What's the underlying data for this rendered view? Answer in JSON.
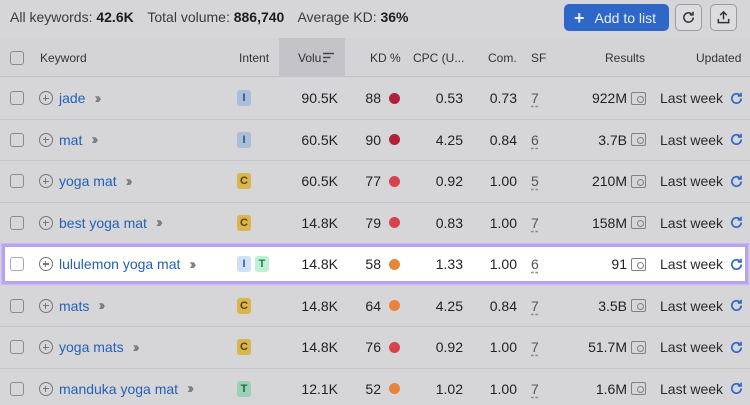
{
  "summary": {
    "keywords_label": "All keywords:",
    "keywords_value": "42.6K",
    "volume_label": "Total volume:",
    "volume_value": "886,740",
    "kd_label": "Average KD:",
    "kd_value": "36%"
  },
  "toolbar": {
    "add_label": "Add to list",
    "refresh_icon": "refresh-icon",
    "export_icon": "export-icon"
  },
  "columns": {
    "keyword": "Keyword",
    "intent": "Intent",
    "volume": "Volu",
    "kd": "KD %",
    "cpc": "CPC (U...",
    "com": "Com.",
    "sf": "SF",
    "results": "Results",
    "updated": "Updated"
  },
  "colors": {
    "accent": "#2f67c9",
    "highlight_border": "#b9a1f3",
    "kd_very_hard": "#b0223a",
    "kd_hard": "#d9424d",
    "kd_difficult": "#e8843a"
  },
  "rows": [
    {
      "keyword": "jade",
      "intents": [
        "I"
      ],
      "volume": "90.5K",
      "kd": "88",
      "kd_color": "#b0223a",
      "cpc": "0.53",
      "com": "0.73",
      "sf": "7",
      "results": "922M",
      "updated": "Last week"
    },
    {
      "keyword": "mat",
      "intents": [
        "I"
      ],
      "volume": "60.5K",
      "kd": "90",
      "kd_color": "#b0223a",
      "cpc": "4.25",
      "com": "0.84",
      "sf": "6",
      "results": "3.7B",
      "updated": "Last week"
    },
    {
      "keyword": "yoga mat",
      "intents": [
        "C"
      ],
      "volume": "60.5K",
      "kd": "77",
      "kd_color": "#d9424d",
      "cpc": "0.92",
      "com": "1.00",
      "sf": "5",
      "results": "210M",
      "updated": "Last week"
    },
    {
      "keyword": "best yoga mat",
      "intents": [
        "C"
      ],
      "volume": "14.8K",
      "kd": "79",
      "kd_color": "#d9424d",
      "cpc": "0.83",
      "com": "1.00",
      "sf": "7",
      "results": "158M",
      "updated": "Last week"
    },
    {
      "keyword": "lululemon yoga mat",
      "intents": [
        "I",
        "T"
      ],
      "volume": "14.8K",
      "kd": "58",
      "kd_color": "#e8843a",
      "cpc": "1.33",
      "com": "1.00",
      "sf": "6",
      "results": "91",
      "updated": "Last week"
    },
    {
      "keyword": "mats",
      "intents": [
        "C"
      ],
      "volume": "14.8K",
      "kd": "64",
      "kd_color": "#e8843a",
      "cpc": "4.25",
      "com": "0.84",
      "sf": "7",
      "results": "3.5B",
      "updated": "Last week"
    },
    {
      "keyword": "yoga mats",
      "intents": [
        "C"
      ],
      "volume": "14.8K",
      "kd": "76",
      "kd_color": "#d9424d",
      "cpc": "0.92",
      "com": "1.00",
      "sf": "7",
      "results": "51.7M",
      "updated": "Last week"
    },
    {
      "keyword": "manduka yoga mat",
      "intents": [
        "T"
      ],
      "volume": "12.1K",
      "kd": "52",
      "kd_color": "#e8843a",
      "cpc": "1.02",
      "com": "1.00",
      "sf": "7",
      "results": "1.6M",
      "updated": "Last week"
    }
  ]
}
